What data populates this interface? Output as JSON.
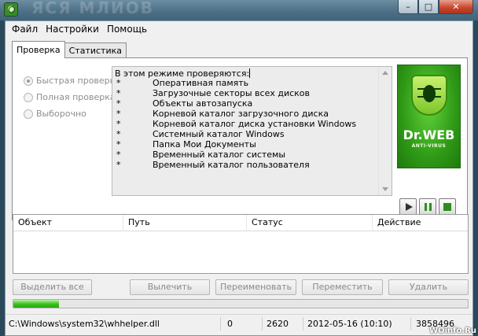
{
  "window": {
    "title_ghost": "ЯСЯ МЛИОВ",
    "min_label": "–",
    "max_label": "□",
    "close_label": "✕"
  },
  "menu": [
    "Файл",
    "Настройки",
    "Помощь"
  ],
  "tabs": [
    "Проверка",
    "Статистика"
  ],
  "scan_modes": [
    {
      "label": "Быстрая проверка",
      "checked": true
    },
    {
      "label": "Полная проверка",
      "checked": false
    },
    {
      "label": "Выборочно",
      "checked": false
    }
  ],
  "info": {
    "heading": "В этом режиме проверяются:",
    "bullet": "*",
    "items": [
      "Оперативная память",
      "Загрузочные секторы всех дисков",
      "Объекты автозапуска",
      "Корневой каталог загрузочного диска",
      "Корневой каталог диска установки Windows",
      "Системный каталог Windows",
      "Папка Мои Документы",
      "Временный каталог системы",
      "Временный каталог пользователя"
    ]
  },
  "logo": {
    "brand": "Dr.WEB",
    "sub": "ANTI-VIRUS",
    "color": "#2f9a17"
  },
  "controls": [
    {
      "name": "play-icon"
    },
    {
      "name": "pause-icon"
    },
    {
      "name": "stop-icon"
    }
  ],
  "table": {
    "headers": [
      "Объект",
      "Путь",
      "Статус",
      "Действие"
    ]
  },
  "actions": [
    "Выделить все",
    "Вылечить",
    "Переименовать",
    "Переместить",
    "Удалить"
  ],
  "progress": {
    "fraction": 0.1
  },
  "status": {
    "path": "C:\\Windows\\system32\\whhelper.dll",
    "count": "0",
    "files": "2620",
    "datetime": "2012-05-16 (10:10)",
    "extra": "3858496"
  },
  "watermark": "WOinfo.Ru"
}
